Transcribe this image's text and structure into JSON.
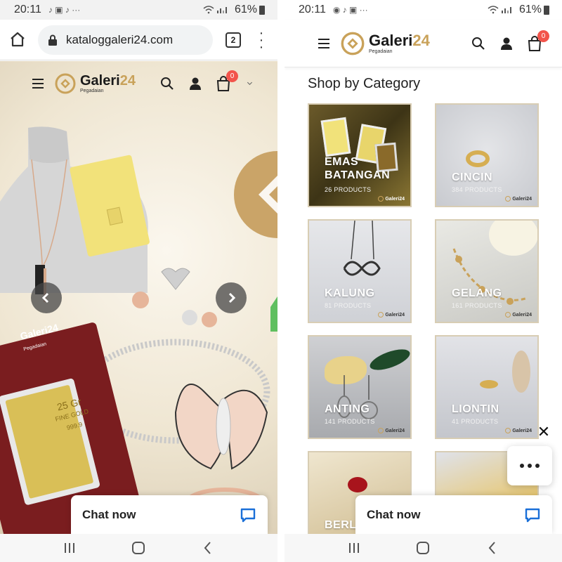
{
  "left": {
    "status": {
      "time": "20:11",
      "notif_icons": "♪ ▣ ♪ ···",
      "signal": "wifi-signal-icons",
      "battery": "61%"
    },
    "browser": {
      "url": "kataloggaleri24.com",
      "tab_count": "2"
    },
    "site": {
      "brand_name": "Galeri",
      "brand_num": "24",
      "brand_sub": "Pegadaian",
      "cart_count": "0"
    },
    "hero": {
      "gold_card_brand": "Galeri24",
      "gold_card_sub": "Pegadaian",
      "gold_weight": "25 Gr",
      "gold_purity": "FINE GOLD",
      "gold_fineness": "999.9"
    },
    "chat": {
      "label": "Chat now"
    }
  },
  "right": {
    "status": {
      "time": "20:11",
      "notif_icons": "◉ ♪ ▣ ···",
      "battery": "61%"
    },
    "site": {
      "brand_name": "Galeri",
      "brand_num": "24",
      "brand_sub": "Pegadaian",
      "cart_count": "0"
    },
    "section_title": "Shop by Category",
    "categories": [
      {
        "name_line1": "EMAS",
        "name_line2": "BATANGAN",
        "count": "26 PRODUCTS"
      },
      {
        "name_line1": "CINCIN",
        "name_line2": "",
        "count": "384 PRODUCTS"
      },
      {
        "name_line1": "KALUNG",
        "name_line2": "",
        "count": "81 PRODUCTS"
      },
      {
        "name_line1": "GELANG",
        "name_line2": "",
        "count": "161 PRODUCTS"
      },
      {
        "name_line1": "ANTING",
        "name_line2": "",
        "count": "141 PRODUCTS"
      },
      {
        "name_line1": "LIONTIN",
        "name_line2": "",
        "count": "41 PRODUCTS"
      },
      {
        "name_line1": "BERLI",
        "name_line2": "",
        "count": ""
      },
      {
        "name_line1": "",
        "name_line2": "",
        "count": ""
      }
    ],
    "tile_logo": "Galeri24",
    "chat": {
      "label": "Chat now"
    }
  },
  "colors": {
    "brand_gold": "#c9a25a",
    "badge_red": "#f2544b",
    "chat_blue": "#1a6fd8"
  }
}
